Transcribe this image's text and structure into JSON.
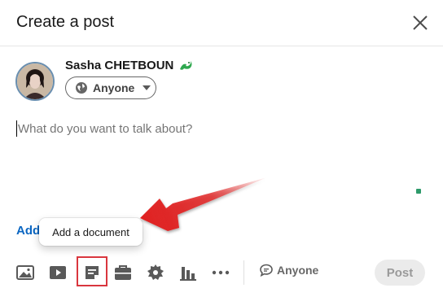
{
  "header": {
    "title": "Create a post"
  },
  "author": {
    "name": "Sasha CHETBOUN",
    "audience": "Anyone"
  },
  "editor": {
    "placeholder": "What do you want to talk about?"
  },
  "add_link": {
    "label": "Add"
  },
  "tooltip": {
    "text": "Add a document"
  },
  "footer": {
    "comment_audience": "Anyone",
    "post_label": "Post"
  },
  "colors": {
    "link": "#0a66c2",
    "highlight": "#d9363e",
    "arrow": "#e02020",
    "status_dot": "#2e9a6a"
  },
  "icons": [
    "close-icon",
    "globe-icon",
    "photo-icon",
    "video-icon",
    "document-icon",
    "job-icon",
    "celebrate-icon",
    "poll-icon",
    "more-icon",
    "comment-icon"
  ]
}
